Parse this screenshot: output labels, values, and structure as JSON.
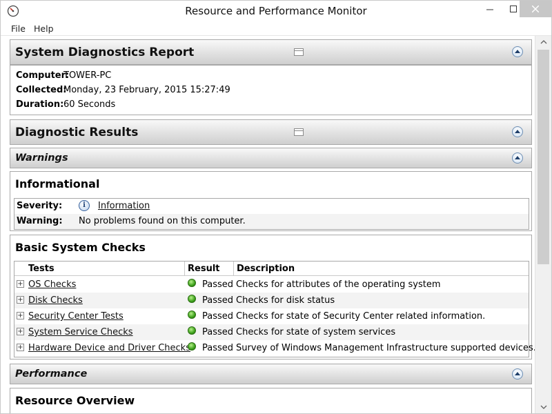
{
  "window": {
    "title": "Resource and Performance Monitor"
  },
  "menu": {
    "file": "File",
    "help": "Help"
  },
  "report": {
    "title": "System Diagnostics Report",
    "computer_label": "Computer:",
    "computer_value": "TOWER-PC",
    "collected_label": "Collected:",
    "collected_value": "Monday, 23 February, 2015 15:27:49",
    "duration_label": "Duration:",
    "duration_value": "60 Seconds"
  },
  "diagnostic_results": {
    "title": "Diagnostic Results"
  },
  "warnings": {
    "title": "Warnings"
  },
  "informational": {
    "title": "Informational",
    "severity_label": "Severity:",
    "severity_value": "Information",
    "warning_label": "Warning:",
    "warning_value": "No problems found on this computer."
  },
  "basic_checks": {
    "title": "Basic System Checks",
    "headers": {
      "tests": "Tests",
      "result": "Result",
      "description": "Description"
    },
    "rows": [
      {
        "test": "OS Checks",
        "result": "Passed",
        "description": "Checks for attributes of the operating system"
      },
      {
        "test": "Disk Checks",
        "result": "Passed",
        "description": "Checks for disk status"
      },
      {
        "test": "Security Center Tests",
        "result": "Passed",
        "description": "Checks for state of Security Center related information."
      },
      {
        "test": "System Service Checks",
        "result": "Passed",
        "description": "Checks for state of system services"
      },
      {
        "test": "Hardware Device and Driver Checks",
        "result": "Passed",
        "description": "Survey of Windows Management Infrastructure supported devices."
      }
    ]
  },
  "performance": {
    "title": "Performance"
  },
  "resource_overview": {
    "title": "Resource Overview"
  },
  "colors": {
    "passed_dot": "#3da11b",
    "close_button": "#c7c7c7",
    "section_header": "#e1e1e1"
  }
}
